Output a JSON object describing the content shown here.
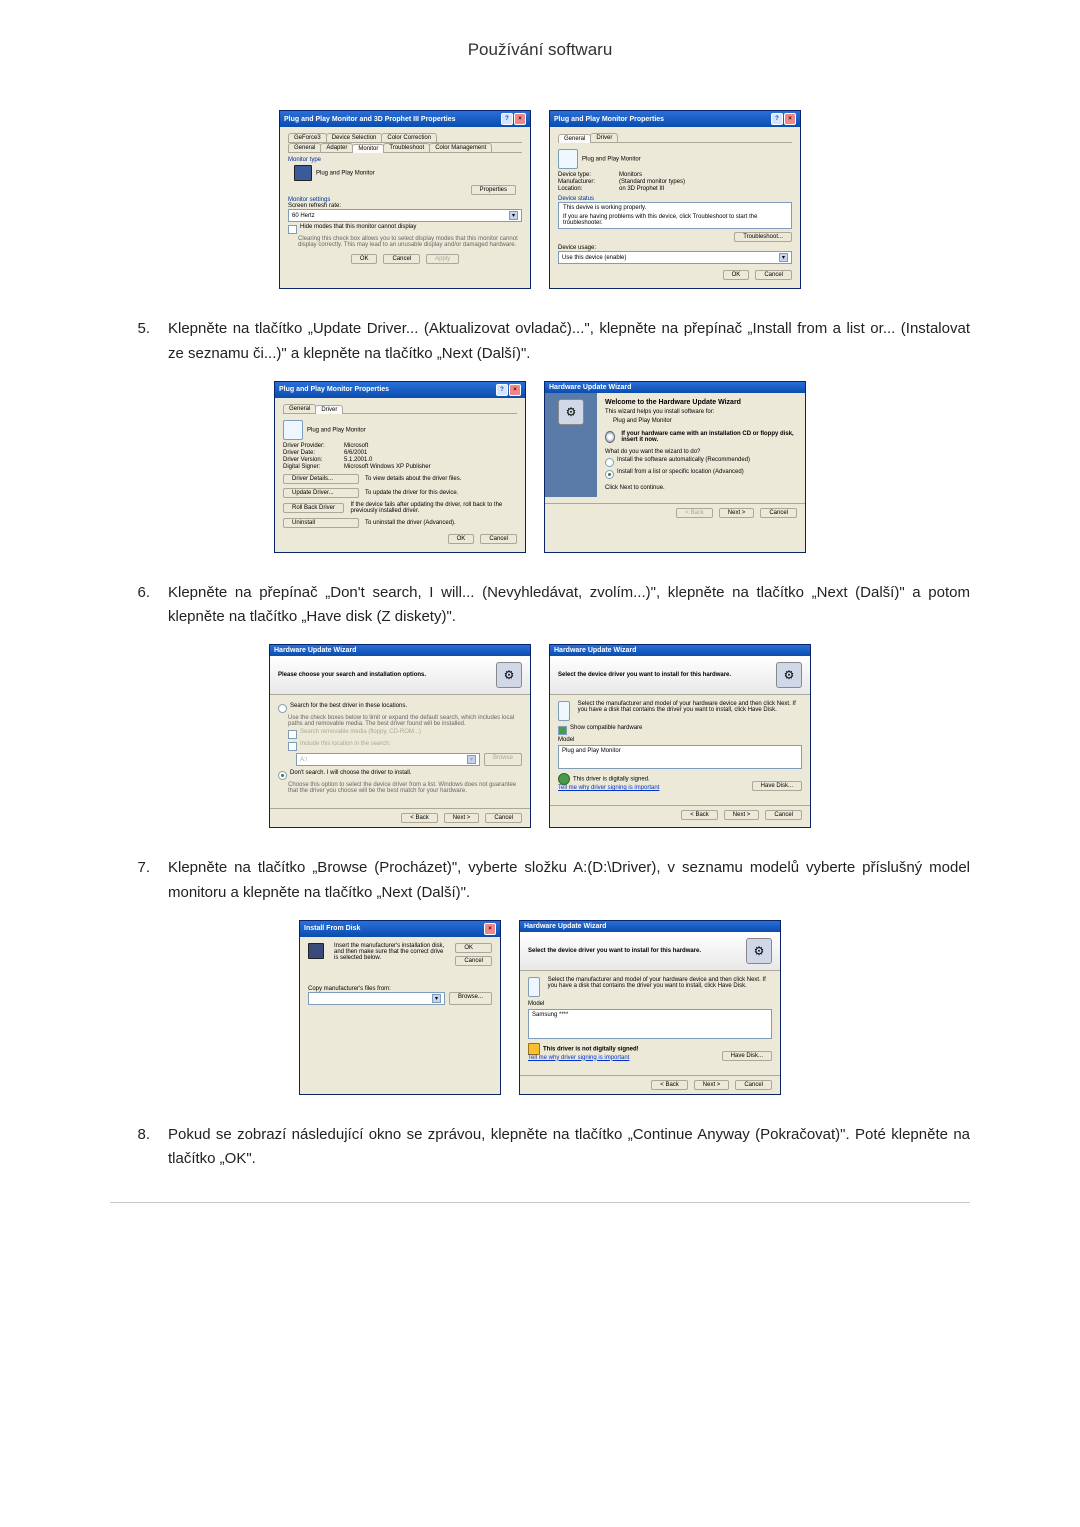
{
  "page_title": "Používání softwaru",
  "steps": {
    "s5": {
      "num": "5.",
      "text": "Klepněte na tlačítko „Update Driver... (Aktualizovat ovladač)...\", klepněte na přepínač „Install from a list or... (Instalovat ze seznamu či...)\" a klepněte na tlačítko „Next (Další)\"."
    },
    "s6": {
      "num": "6.",
      "text": "Klepněte na přepínač „Don't search, I will... (Nevyhledávat, zvolím...)\", klepněte na tlačítko „Next (Další)\" a potom klepněte na tlačítko „Have disk (Z diskety)\"."
    },
    "s7": {
      "num": "7.",
      "text": "Klepněte na tlačítko „Browse (Procházet)\", vyberte složku A:(D:\\Driver), v seznamu modelů vyberte příslušný model monitoru a klepněte na tlačítko „Next (Další)\"."
    },
    "s8": {
      "num": "8.",
      "text": "Pokud se zobrazí následující okno se zprávou, klepněte na tlačítko „Continue Anyway (Pokračovat)\". Poté klepněte na tlačítko „OK\"."
    }
  },
  "dlg1a": {
    "title": "Plug and Play Monitor and 3D Prophet III Properties",
    "tabs": [
      "GeForce3",
      "Device Selection",
      "Color Correction",
      "General",
      "Adapter",
      "Monitor",
      "Troubleshoot",
      "Color Management"
    ],
    "monitor_type": "Monitor type",
    "monitor_name": "Plug and Play Monitor",
    "properties_btn": "Properties",
    "settings_label": "Monitor settings",
    "refresh_label": "Screen refresh rate:",
    "refresh_value": "60 Hertz",
    "hide_label": "Hide modes that this monitor cannot display",
    "hide_desc": "Clearing this check box allows you to select display modes that this monitor cannot display correctly. This may lead to an unusable display and/or damaged hardware.",
    "ok": "OK",
    "cancel": "Cancel",
    "apply": "Apply"
  },
  "dlg1b": {
    "title": "Plug and Play Monitor Properties",
    "tab_general": "General",
    "tab_driver": "Driver",
    "name": "Plug and Play Monitor",
    "dt_label": "Device type:",
    "dt_value": "Monitors",
    "mf_label": "Manufacturer:",
    "mf_value": "(Standard monitor types)",
    "loc_label": "Location:",
    "loc_value": "on 3D Prophet III",
    "status_label": "Device status",
    "status_text": "This devive is working properly.",
    "status_help": "If you are having problems with this device, click Troubleshoot to start the troubleshooter.",
    "troubleshoot": "Troubleshoot...",
    "usage_label": "Device usage:",
    "usage_value": "Use this device (enable)",
    "ok": "OK",
    "cancel": "Cancel"
  },
  "dlg2a": {
    "title": "Plug and Play Monitor Properties",
    "tab_general": "General",
    "tab_driver": "Driver",
    "name": "Plug and Play Monitor",
    "dp_label": "Driver Provider:",
    "dp_value": "Microsoft",
    "dd_label": "Driver Date:",
    "dd_value": "6/6/2001",
    "dv_label": "Driver Version:",
    "dv_value": "5.1.2001.0",
    "ds_label": "Digital Signer:",
    "ds_value": "Microsoft Windows XP Publisher",
    "details_btn": "Driver Details...",
    "details_desc": "To view details about the driver files.",
    "update_btn": "Update Driver...",
    "update_desc": "To update the driver for this device.",
    "rollback_btn": "Roll Back Driver",
    "rollback_desc": "If the device fails after updating the driver, roll back to the previously installed driver.",
    "uninstall_btn": "Uninstall",
    "uninstall_desc": "To uninstall the driver (Advanced).",
    "ok": "OK",
    "cancel": "Cancel"
  },
  "dlg2b": {
    "title": "Hardware Update Wizard",
    "welcome": "Welcome to the Hardware Update Wizard",
    "helps": "This wizard helps you install software for:",
    "device": "Plug and Play Monitor",
    "cd_tip": "If your hardware came with an installation CD or floppy disk, insert it now.",
    "question": "What do you want the wizard to do?",
    "opt1": "Install the software automatically (Recommended)",
    "opt2": "Install from a list or specific location (Advanced)",
    "continue": "Click Next to continue.",
    "back": "< Back",
    "next": "Next >",
    "cancel": "Cancel"
  },
  "dlg3a": {
    "title": "Hardware Update Wizard",
    "header": "Please choose your search and installation options.",
    "opt1": "Search for the best driver in these locations.",
    "opt1_desc": "Use the check boxes below to limit or expand the default search, which includes local paths and removable media. The best driver found will be installed.",
    "chk1": "Search removable media (floppy, CD-ROM...)",
    "chk2": "Include this location in the search:",
    "path": "A:\\",
    "browse": "Browse",
    "opt2": "Don't search. I will choose the driver to install.",
    "opt2_desc": "Choose this option to select the device driver from a list. Windows does not guarantee that the driver you choose will be the best match for your hardware.",
    "back": "< Back",
    "next": "Next >",
    "cancel": "Cancel"
  },
  "dlg3b": {
    "title": "Hardware Update Wizard",
    "header": "Select the device driver you want to install for this hardware.",
    "instr": "Select the manufacturer and model of your hardware device and then click Next. If you have a disk that contains the driver you want to install, click Have Disk.",
    "compat": "Show compatible hardware",
    "model_label": "Model",
    "model": "Plug and Play Monitor",
    "signed": "This driver is digitally signed.",
    "tell": "Tell me why driver signing is important",
    "have_disk": "Have Disk...",
    "back": "< Back",
    "next": "Next >",
    "cancel": "Cancel"
  },
  "dlg4a": {
    "title": "Install From Disk",
    "instr": "Insert the manufacturer's installation disk, and then make sure that the correct drive is selected below.",
    "ok": "OK",
    "cancel": "Cancel",
    "copy_label": "Copy manufacturer's files from:",
    "path": "",
    "browse": "Browse..."
  },
  "dlg4b": {
    "title": "Hardware Update Wizard",
    "header": "Select the device driver you want to install for this hardware.",
    "instr": "Select the manufacturer and model of your hardware device and then click Next. If you have a disk that contains the driver you want to install, click Have Disk.",
    "model_label": "Model",
    "model": "Samsung ****",
    "not_signed": "This driver is not digitally signed!",
    "tell": "Tell me why driver signing is important",
    "have_disk": "Have Disk...",
    "back": "< Back",
    "next": "Next >",
    "cancel": "Cancel"
  }
}
